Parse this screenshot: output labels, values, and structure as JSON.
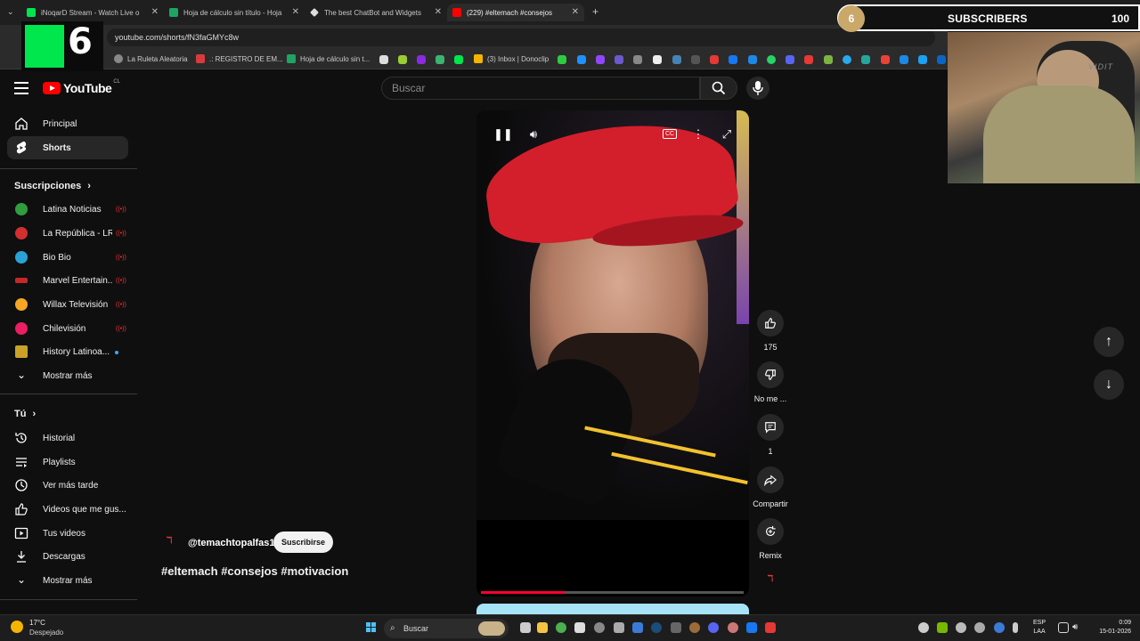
{
  "browser": {
    "tabs": [
      {
        "label": "iNoqarD Stream - Watch Live o"
      },
      {
        "label": "Hoja de cálculo sin título - Hoja"
      },
      {
        "label": "The best ChatBot and Widgets"
      },
      {
        "label": "(229) #eltemach #consejos"
      }
    ],
    "url": "youtube.com/shorts/fN3faGMYc8w",
    "bookmarks": [
      "La Ruleta Aleatoria",
      ".: REGISTRO DE EM...",
      "Hoja de cálculo sin t...",
      "(3) Inbox | Donoclip"
    ]
  },
  "overlay": {
    "kick_number": "6",
    "sub_circle": "6",
    "sub_label": "SUBSCRIBERS",
    "sub_count": "100",
    "webcam_text": "VIDIT"
  },
  "header": {
    "logo": "YouTube",
    "region": "CL",
    "search_placeholder": "Buscar"
  },
  "sidebar": {
    "main": [
      {
        "label": "Principal",
        "icon": "home-icon"
      },
      {
        "label": "Shorts",
        "icon": "shorts-icon"
      }
    ],
    "subscriptions_title": "Suscripciones",
    "subscriptions": [
      {
        "label": "Latina Noticias",
        "color": "#2e9e3e",
        "status": "live"
      },
      {
        "label": "La República - LR+",
        "color": "#d32f2f",
        "status": "live"
      },
      {
        "label": "Bio Bio",
        "color": "#29a3d6",
        "status": "live"
      },
      {
        "label": "Marvel Entertain...",
        "color": "#c62828",
        "status": "live"
      },
      {
        "label": "Willax Televisión",
        "color": "#f5a623",
        "status": "live"
      },
      {
        "label": "Chilevisión",
        "color": "#e91e63",
        "status": "live"
      },
      {
        "label": "History Latinoa...",
        "color": "#c9a227",
        "status": "new"
      }
    ],
    "show_more": "Mostrar más",
    "you_title": "Tú",
    "you": [
      {
        "label": "Historial",
        "icon": "history-icon"
      },
      {
        "label": "Playlists",
        "icon": "playlists-icon"
      },
      {
        "label": "Ver más tarde",
        "icon": "clock-icon"
      },
      {
        "label": "Videos que me gus...",
        "icon": "thumbs-up-icon"
      },
      {
        "label": "Tus videos",
        "icon": "your-videos-icon"
      },
      {
        "label": "Descargas",
        "icon": "download-icon"
      }
    ],
    "you_show_more": "Mostrar más"
  },
  "short": {
    "progress": 0.32,
    "actions": {
      "likes": "175",
      "dislike": "No me ...",
      "comments": "1",
      "share": "Compartir",
      "remix": "Remix"
    },
    "channel": "@temachtopalfas1",
    "subscribe": "Suscribirse",
    "title": "#eltemach #consejos #motivacion"
  },
  "taskbar": {
    "temp": "17°C",
    "weather": "Despejado",
    "search": "Buscar",
    "lang1": "ESP",
    "lang2": "LAA",
    "time": "0:09",
    "date": "15-01-2026"
  }
}
